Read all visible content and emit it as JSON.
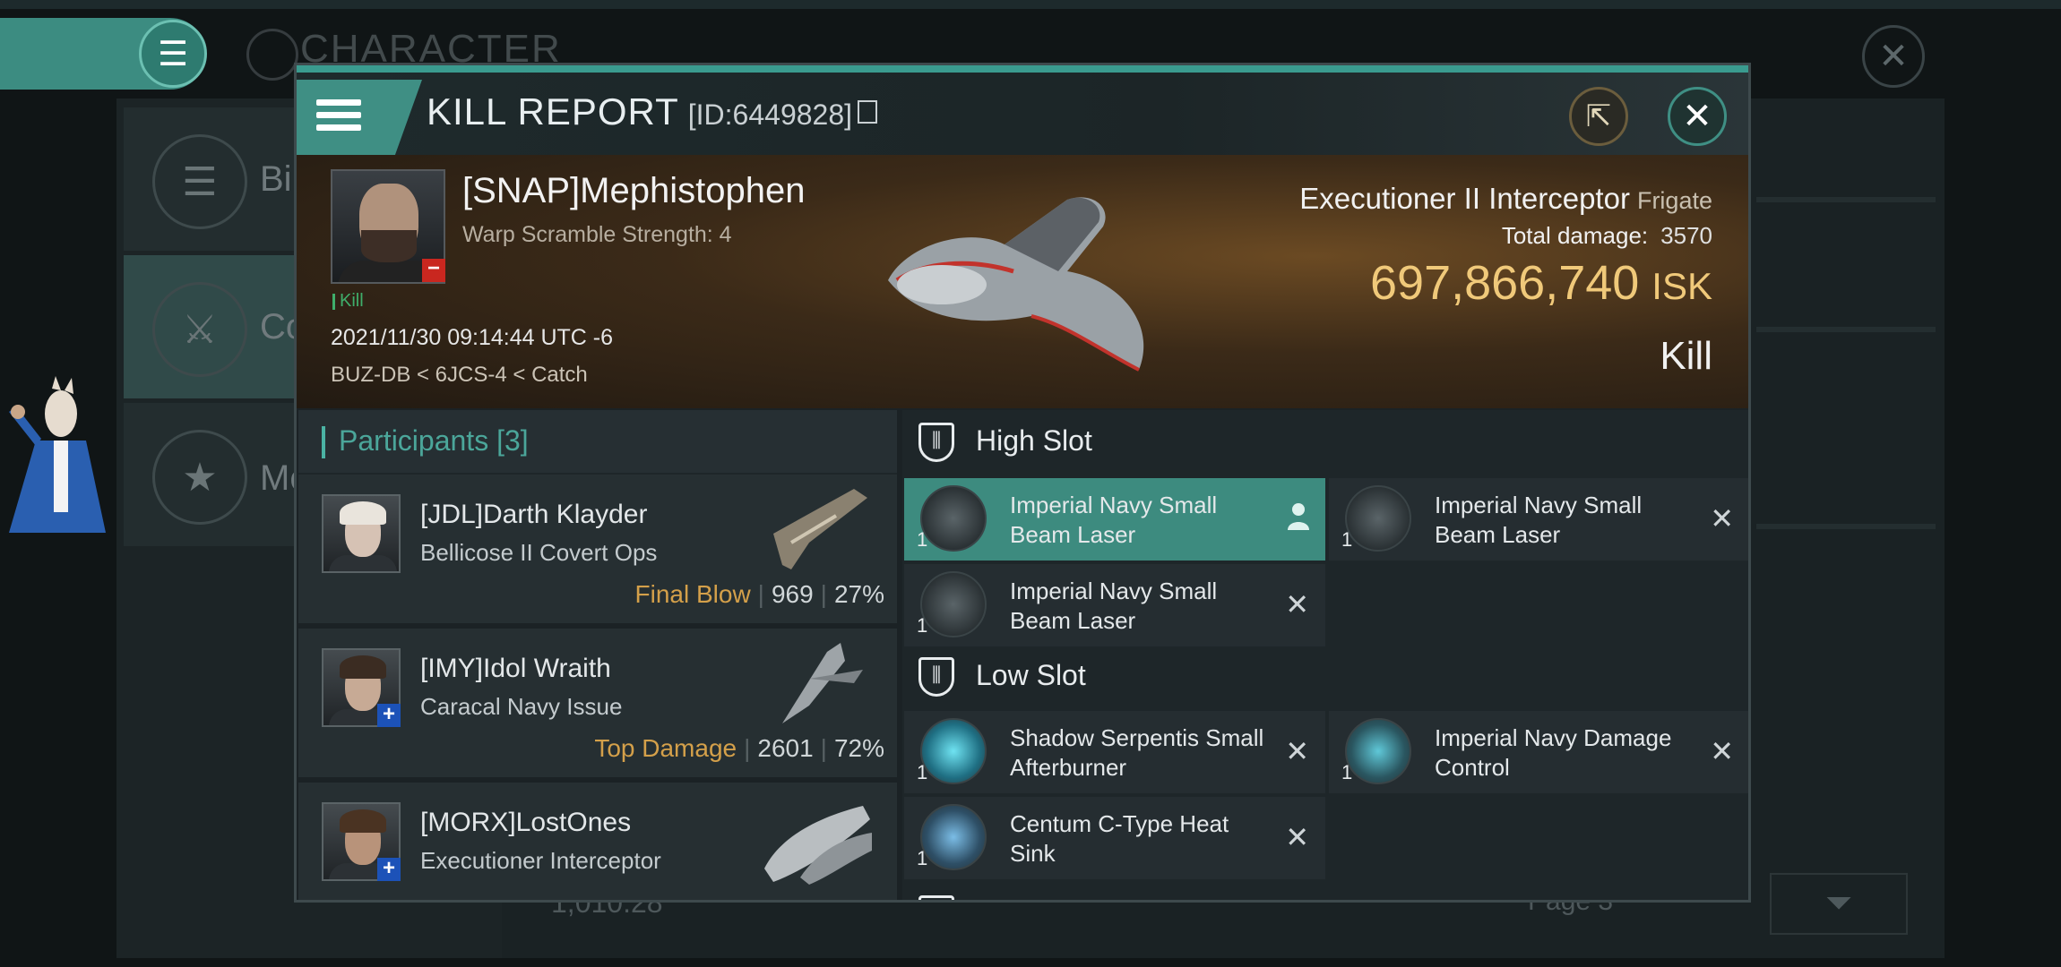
{
  "background": {
    "title": "CHARACTER",
    "side_items": [
      {
        "label": "Bi",
        "icon": "list-icon"
      },
      {
        "label": "Co",
        "icon": "crossed-swords-icon"
      },
      {
        "label": "Me",
        "icon": "star-icon"
      }
    ],
    "bottom_value": "1,010.28",
    "page_label": "Page 3"
  },
  "modal": {
    "title": "KILL REPORT",
    "id": "[ID:6449828]"
  },
  "victim": {
    "name": "[SNAP]Mephistophen",
    "sub": "Warp Scramble Strength: 4",
    "tag": "Kill",
    "date": "2021/11/30 09:14:44 UTC -6",
    "location": "BUZ-DB < 6JCS-4 < Catch",
    "ship_name": "Executioner II Interceptor",
    "ship_class": "Frigate",
    "damage_label": "Total damage:",
    "damage_value": "3570",
    "isk_value": "697,866,740",
    "isk_unit": "ISK",
    "result": "Kill"
  },
  "participants": {
    "title": "Participants",
    "count": "[3]",
    "items": [
      {
        "name": "[JDL]Darth Klayder",
        "ship": "Bellicose II Covert Ops",
        "label": "Final Blow",
        "damage": "969",
        "percent": "27%"
      },
      {
        "name": "[IMY]Idol Wraith",
        "ship": "Caracal Navy Issue",
        "label": "Top Damage",
        "damage": "2601",
        "percent": "72%"
      },
      {
        "name": "[MORX]LostOnes",
        "ship": "Executioner Interceptor",
        "label": "",
        "damage": "",
        "percent": ""
      }
    ]
  },
  "fitting": {
    "high_slot": "High Slot",
    "low_slot": "Low Slot",
    "high_modules": [
      {
        "name": "Imperial Navy Small Beam Laser",
        "qty": "1"
      },
      {
        "name": "Imperial Navy Small Beam Laser",
        "qty": "1"
      },
      {
        "name": "Imperial Navy Small Beam Laser",
        "qty": "1"
      }
    ],
    "low_modules": [
      {
        "name": "Shadow Serpentis Small Afterburner",
        "qty": "1"
      },
      {
        "name": "Imperial Navy Damage Control",
        "qty": "1"
      },
      {
        "name": "Centum C-Type Heat Sink",
        "qty": "1"
      }
    ]
  },
  "colors": {
    "accent": "#3d8b7f",
    "isk": "#f0c97a",
    "final_blow": "#d4a04a",
    "kill_tag": "#3fae6b"
  }
}
